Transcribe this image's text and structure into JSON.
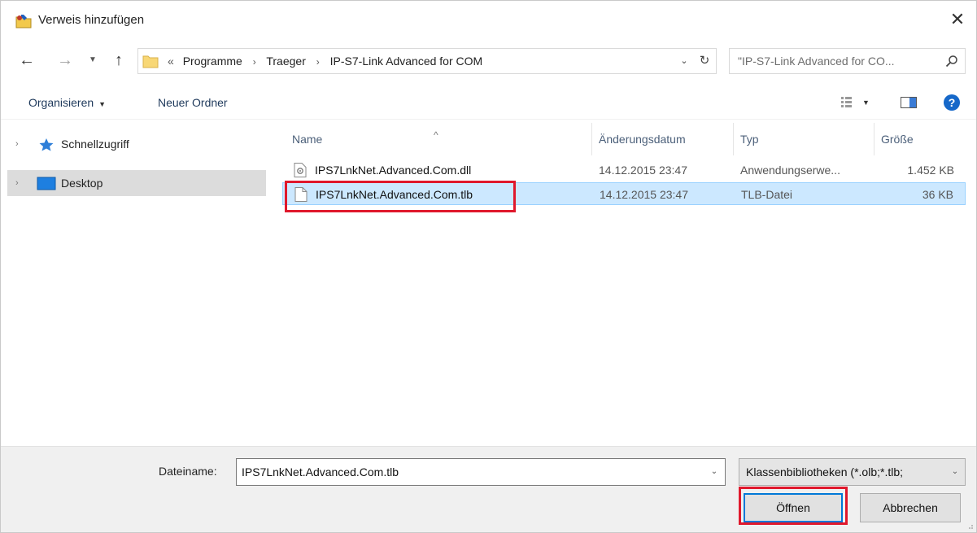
{
  "window": {
    "title": "Verweis hinzufügen",
    "close_glyph": "✕"
  },
  "address_bar": {
    "overflow_glyph": "«",
    "crumbs": [
      "Programme",
      "Traeger",
      "IP-S7-Link Advanced for COM"
    ],
    "separator": "›"
  },
  "search": {
    "placeholder": "\"IP-S7-Link Advanced for CO..."
  },
  "toolbar": {
    "organize_label": "Organisieren",
    "new_folder_label": "Neuer Ordner"
  },
  "nav_pane": {
    "items": [
      {
        "label": "Schnellzugriff",
        "icon": "star-icon"
      },
      {
        "label": "Desktop",
        "icon": "desktop-icon",
        "selected": true
      }
    ]
  },
  "file_list": {
    "columns": {
      "name": "Name",
      "date": "Änderungsdatum",
      "type": "Typ",
      "size": "Größe"
    },
    "rows": [
      {
        "name": "IPS7LnkNet.Advanced.Com.dll",
        "date": "14.12.2015 23:47",
        "type": "Anwendungserwe...",
        "size": "1.452 KB",
        "icon": "dll-file-icon",
        "selected": false
      },
      {
        "name": "IPS7LnkNet.Advanced.Com.tlb",
        "date": "14.12.2015 23:47",
        "type": "TLB-Datei",
        "size": "36 KB",
        "icon": "file-icon",
        "selected": true
      }
    ]
  },
  "bottom": {
    "filename_label": "Dateiname:",
    "filename_value": "IPS7LnkNet.Advanced.Com.tlb",
    "filter_value": "Klassenbibliotheken (*.olb;*.tlb;",
    "open_label": "Öffnen",
    "cancel_label": "Abbrechen"
  },
  "colors": {
    "selection_bg": "#cce8ff",
    "highlight_box": "#e0182c",
    "accent": "#0078d7"
  }
}
